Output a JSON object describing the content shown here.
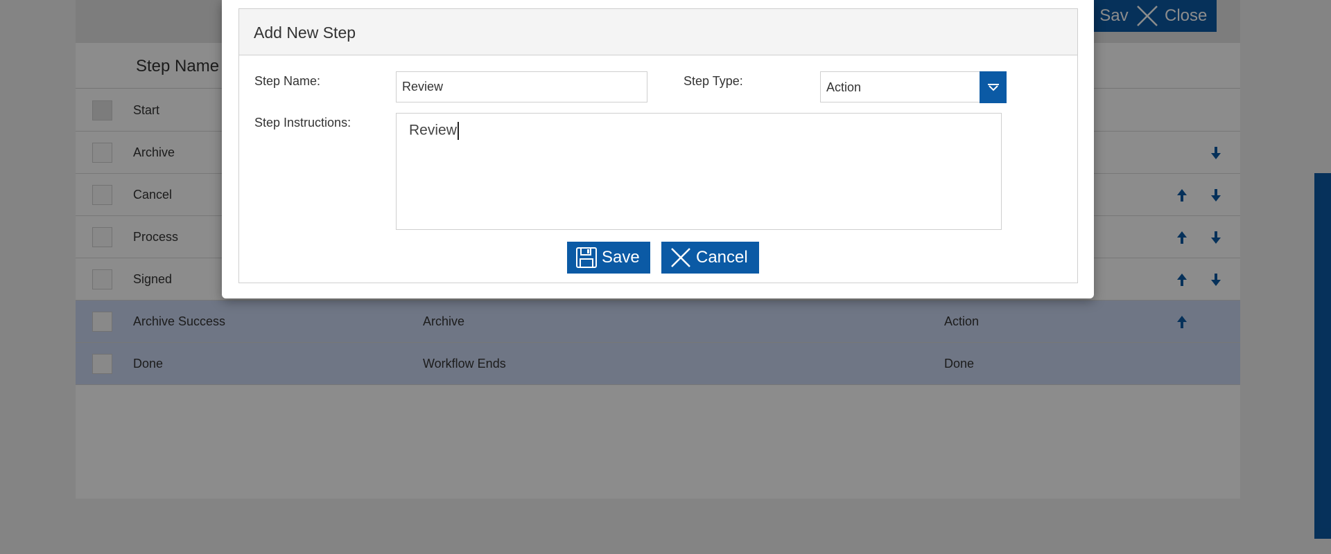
{
  "background_app": {
    "toolbar": {
      "save_label": "Save",
      "close_label": "Close"
    },
    "table": {
      "header_step_name": "Step Name",
      "rows": [
        {
          "name": "Start",
          "col2": "",
          "col3": "",
          "up": false,
          "down": false,
          "selected": false
        },
        {
          "name": "Archive",
          "col2": "",
          "col3": "",
          "up": false,
          "down": true,
          "selected": false
        },
        {
          "name": "Cancel",
          "col2": "",
          "col3": "",
          "up": true,
          "down": true,
          "selected": false
        },
        {
          "name": "Process",
          "col2": "",
          "col3": "",
          "up": true,
          "down": true,
          "selected": false
        },
        {
          "name": "Signed",
          "col2": "",
          "col3": "",
          "up": true,
          "down": true,
          "selected": false
        },
        {
          "name": "Archive Success",
          "col2": "Archive",
          "col3": "Action",
          "up": true,
          "down": false,
          "selected": true
        },
        {
          "name": "Done",
          "col2": "Workflow Ends",
          "col3": "Done",
          "up": false,
          "down": false,
          "selected": true
        }
      ]
    }
  },
  "modal": {
    "title": "Add New Step",
    "step_name_label": "Step Name:",
    "step_name_value": "Review",
    "step_type_label": "Step Type:",
    "step_type_value": "Action",
    "instructions_label": "Step Instructions:",
    "instructions_value": "Review",
    "save_label": "Save",
    "cancel_label": "Cancel"
  },
  "colors": {
    "accent": "#0b5aa5",
    "selected_row": "#cbd7f2"
  },
  "icons": {
    "close": "close-x-icon",
    "save": "floppy-disk-icon",
    "dropdown": "chevron-down-icon",
    "up": "arrow-up-icon",
    "down": "arrow-down-icon"
  }
}
